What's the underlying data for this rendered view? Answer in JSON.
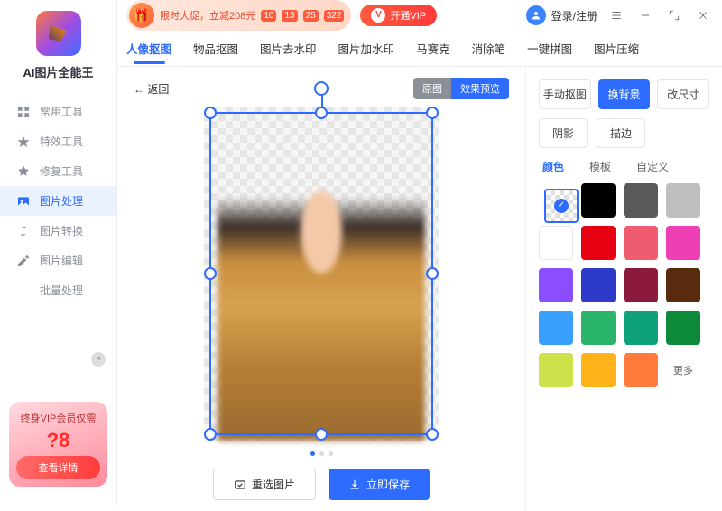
{
  "app_name": "AI图片全能王",
  "topbar": {
    "sale_text": "限时大促，立减208元",
    "countdown": [
      "10",
      "13",
      "25",
      "322"
    ],
    "vip_label": "开通VIP",
    "login_label": "登录/注册"
  },
  "sidebar": {
    "items": [
      {
        "label": "常用工具"
      },
      {
        "label": "特效工具"
      },
      {
        "label": "修复工具"
      },
      {
        "label": "图片处理"
      },
      {
        "label": "图片转换"
      },
      {
        "label": "图片编辑"
      },
      {
        "label": "批量处理"
      }
    ],
    "promo": {
      "line1": "终身VIP会员仅需",
      "price": "?8",
      "btn": "查看详情"
    }
  },
  "tabs": [
    "人像抠图",
    "物品抠图",
    "图片去水印",
    "图片加水印",
    "马赛克",
    "消除笔",
    "一键拼图",
    "图片压缩"
  ],
  "canvas": {
    "back": "←  返回",
    "view_a": "原图",
    "view_b": "效果预览",
    "reselect": "重选图片",
    "save": "立即保存"
  },
  "panel": {
    "row1": [
      "手动抠图",
      "换背景",
      "改尺寸"
    ],
    "row2": [
      "阴影",
      "描边"
    ],
    "subtabs": [
      "颜色",
      "模板",
      "自定义"
    ],
    "more": "更多",
    "colors": [
      {
        "v": "transparent",
        "sel": true
      },
      {
        "v": "#000000"
      },
      {
        "v": "#595959"
      },
      {
        "v": "#bfbfbf"
      },
      {
        "v": "#ffffff"
      },
      {
        "v": "#e60012"
      },
      {
        "v": "#ef5b6f"
      },
      {
        "v": "#ef3fb5"
      },
      {
        "v": "#8a4dff"
      },
      {
        "v": "#2d39c9"
      },
      {
        "v": "#8c1a3a"
      },
      {
        "v": "#5a2a0f"
      },
      {
        "v": "#3aa0ff"
      },
      {
        "v": "#2bb56a"
      },
      {
        "v": "#0fa17a"
      },
      {
        "v": "#0c8a3a"
      },
      {
        "v": "#cde24a"
      },
      {
        "v": "#ffb31a"
      },
      {
        "v": "#ff7a3b"
      }
    ]
  }
}
